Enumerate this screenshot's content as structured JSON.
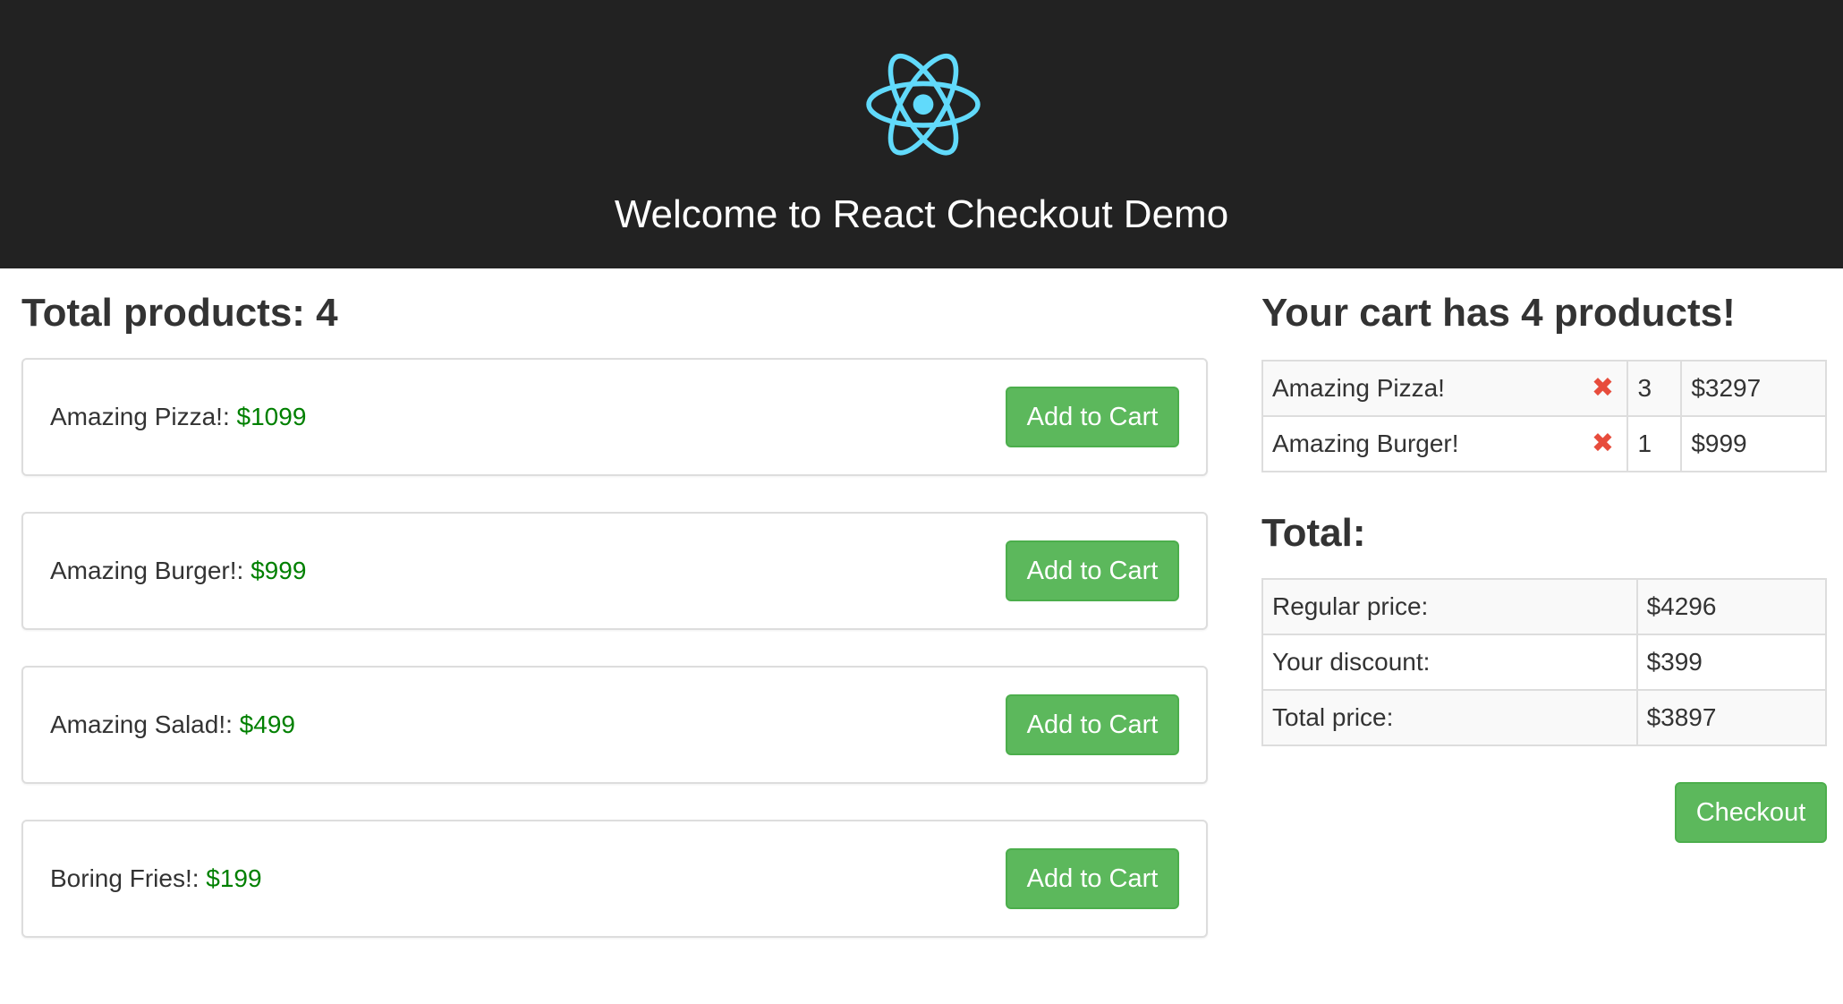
{
  "header": {
    "title": "Welcome to React Checkout Demo",
    "logo_icon": "react-atom-icon",
    "logo_color": "#61dafb",
    "background": "#222222"
  },
  "products": {
    "heading": "Total products: 4",
    "items": [
      {
        "name": "Amazing Pizza!:",
        "price": "$1099",
        "button_label": "Add to Cart"
      },
      {
        "name": "Amazing Burger!:",
        "price": "$999",
        "button_label": "Add to Cart"
      },
      {
        "name": "Amazing Salad!:",
        "price": "$499",
        "button_label": "Add to Cart"
      },
      {
        "name": "Boring Fries!:",
        "price": "$199",
        "button_label": "Add to Cart"
      }
    ],
    "price_color": "#008000"
  },
  "cart": {
    "heading": "Your cart has 4 products!",
    "remove_icon": "close-icon",
    "remove_glyph": "✖",
    "items": [
      {
        "name": "Amazing Pizza!",
        "quantity": "3",
        "total": "$3297"
      },
      {
        "name": "Amazing Burger!",
        "quantity": "1",
        "total": "$999"
      }
    ]
  },
  "totals": {
    "heading": "Total:",
    "rows": [
      {
        "label": "Regular price:",
        "value": "$4296"
      },
      {
        "label": "Your discount:",
        "value": "$399"
      },
      {
        "label": "Total price:",
        "value": "$3897"
      }
    ]
  },
  "checkout": {
    "button_label": "Checkout"
  },
  "colors": {
    "button_green": "#5cb85c",
    "remove_red": "#e74c3c"
  }
}
